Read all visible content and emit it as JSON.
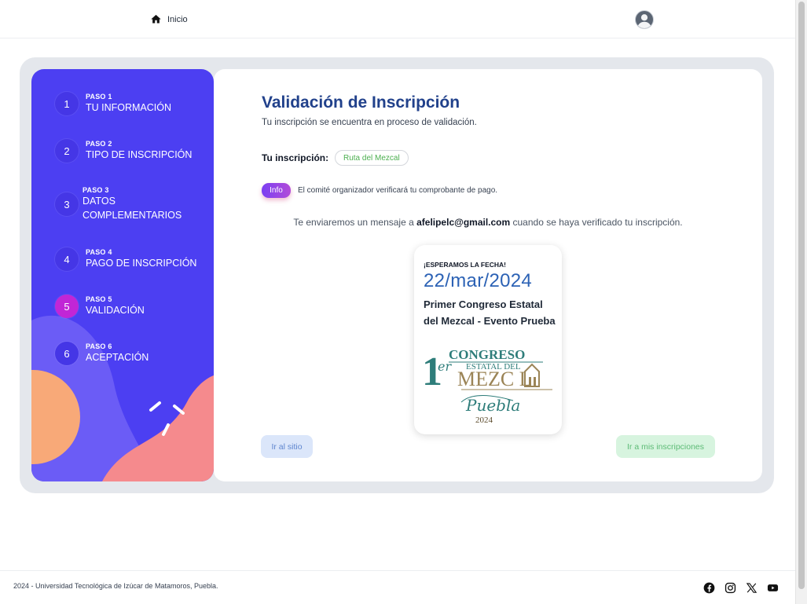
{
  "nav": {
    "home_label": "Inicio"
  },
  "steps": [
    {
      "num": "1",
      "label": "PASO 1",
      "title1": "TU INFORMACIÓN",
      "title2": ""
    },
    {
      "num": "2",
      "label": "PASO 2",
      "title1": "TIPO DE INSCRIPCIÓN",
      "title2": ""
    },
    {
      "num": "3",
      "label": "PASO 3",
      "title1": "DATOS",
      "title2": "COMPLEMENTARIOS"
    },
    {
      "num": "4",
      "label": "PASO 4",
      "title1": "PAGO DE INSCRIPCIÓN",
      "title2": ""
    },
    {
      "num": "5",
      "label": "PASO 5",
      "title1": "VALIDACIÓN",
      "title2": ""
    },
    {
      "num": "6",
      "label": "PASO 6",
      "title1": "ACEPTACIÓN",
      "title2": ""
    }
  ],
  "main": {
    "title": "Validación de Inscripción",
    "subtitle": "Tu inscripción se encuentra en proceso de validación.",
    "inscripcion_label": "Tu inscripción:",
    "inscripcion_value": "Ruta del Mezcal",
    "info_badge": "Info",
    "info_text": "El comité organizador verificará tu comprobante de pago.",
    "message_before": "Te enviaremos un mensaje a ",
    "email": "afelipelc@gmail.com",
    "message_after": " cuando se haya verificado tu inscripción."
  },
  "card": {
    "kicker": "¡ESPERAMOS LA FECHA!",
    "date": "22/mar/2024",
    "event": "Primer Congreso Estatal del Mezcal - Evento Prueba",
    "logo": {
      "big_one": "1",
      "er": "er",
      "congreso": "CONGRESO",
      "estatal": "ESTATAL DEL",
      "mezcal": "MEZC  L",
      "puebla": "Puebla",
      "year": "2024"
    }
  },
  "buttons": {
    "site": "Ir al sitio",
    "inscripciones": "Ir a mis inscripciones"
  },
  "footer": {
    "text": "2024 - Universidad Tecnológica de Izúcar de Matamoros, Puebla."
  },
  "colors": {
    "sidebar": "#4c3ff2",
    "active_step": "#c126d6",
    "title": "#21418b",
    "date": "#2c62b5",
    "badge_text": "#4caf50"
  },
  "icons": [
    "home-icon",
    "user-avatar-icon",
    "facebook-icon",
    "instagram-icon",
    "x-icon",
    "youtube-icon"
  ]
}
